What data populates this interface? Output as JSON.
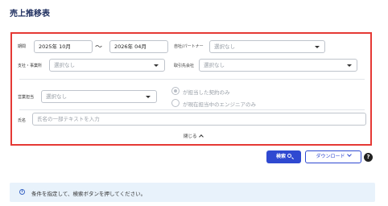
{
  "page": {
    "title": "売上推移表"
  },
  "filters": {
    "period": {
      "label": "期間",
      "from": "2025年 10月",
      "separator": "〜",
      "to": "2026年 04月"
    },
    "company_partner": {
      "label": "自社/パートナー",
      "placeholder": "選択なし"
    },
    "branch_office": {
      "label": "支社・事業所",
      "placeholder": "選択なし"
    },
    "client_company": {
      "label": "取引先会社",
      "placeholder": "選択なし"
    },
    "sales_rep": {
      "label": "営業担当",
      "placeholder": "選択なし"
    },
    "contract_scope": {
      "options": [
        {
          "label": "が担当した契約のみ",
          "selected": true
        },
        {
          "label": "が現在担当中のエンジニアのみ",
          "selected": false
        }
      ]
    },
    "name": {
      "label": "氏名",
      "placeholder": "氏名の一部テキストを入力"
    },
    "close_label": "閉じる"
  },
  "actions": {
    "search_label": "検索",
    "download_label": "ダウンロード",
    "help_symbol": "?"
  },
  "info": {
    "symbol": "i",
    "message": "条件を指定して、検索ボタンを押してください。"
  },
  "colors": {
    "accent": "#2f49d1",
    "highlight_border": "#e53935",
    "title": "#1d2d5e",
    "info_bg": "#e8f2fb"
  }
}
